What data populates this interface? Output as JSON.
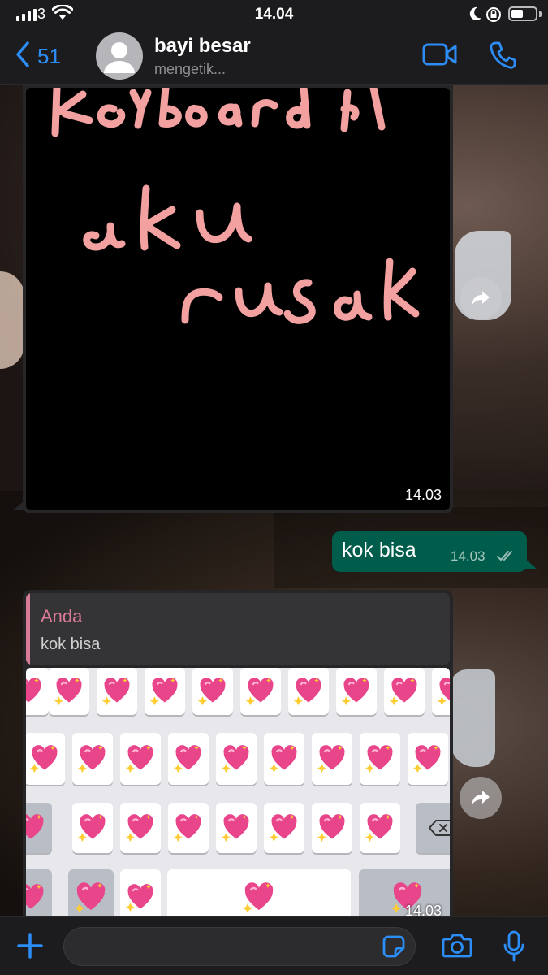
{
  "status_bar": {
    "carrier": "3",
    "time": "14.04"
  },
  "header": {
    "back_count": "51",
    "contact_name": "bayi besar",
    "status": "mengetik..."
  },
  "messages": [
    {
      "direction": "incoming",
      "type": "image",
      "image_text": "keyboard aku rusak",
      "time": "14.03"
    },
    {
      "direction": "outgoing",
      "type": "text",
      "text": "kok bisa",
      "time": "14.03",
      "read": true
    },
    {
      "direction": "incoming",
      "type": "image-reply",
      "quote_author": "Anda",
      "quote_text": "kok bisa",
      "time": "14.03"
    }
  ],
  "colors": {
    "accent": "#2b8df5",
    "outgoing_bubble": "#005c4b",
    "incoming_bubble": "#262628",
    "quote_accent": "#d87b96",
    "handwriting": "#f2a0a0"
  },
  "icons": [
    "signal-icon",
    "wifi-icon",
    "do-not-disturb-icon",
    "orientation-lock-icon",
    "battery-icon",
    "back-chevron-icon",
    "video-call-icon",
    "phone-icon",
    "forward-icon",
    "double-check-icon",
    "plus-icon",
    "sticker-icon",
    "camera-icon",
    "microphone-icon",
    "sparkling-heart-icon"
  ]
}
